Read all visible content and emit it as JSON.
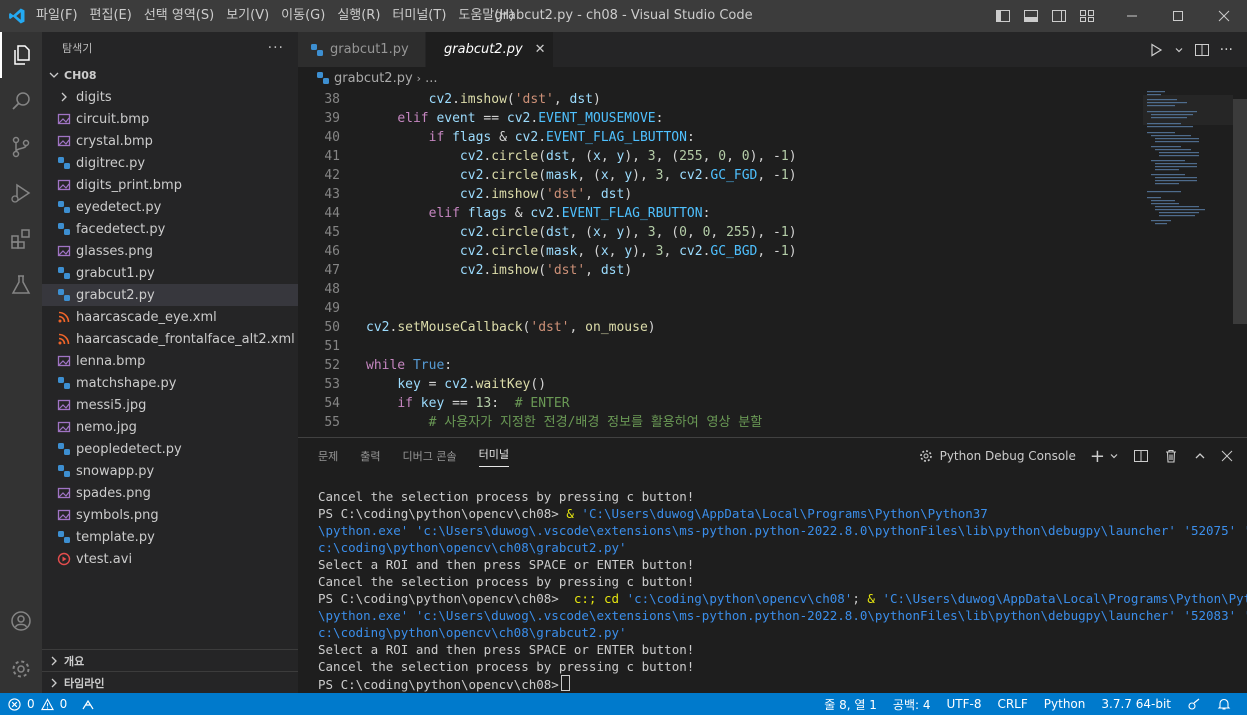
{
  "window": {
    "title": "grabcut2.py - ch08 - Visual Studio Code"
  },
  "menu": [
    "파일(F)",
    "편집(E)",
    "선택 영역(S)",
    "보기(V)",
    "이동(G)",
    "실행(R)",
    "터미널(T)",
    "도움말(H)"
  ],
  "explorer": {
    "title": "탐색기",
    "folder": "CH08",
    "items": [
      {
        "name": "digits",
        "type": "folder"
      },
      {
        "name": "circuit.bmp",
        "type": "image"
      },
      {
        "name": "crystal.bmp",
        "type": "image"
      },
      {
        "name": "digitrec.py",
        "type": "python"
      },
      {
        "name": "digits_print.bmp",
        "type": "image"
      },
      {
        "name": "eyedetect.py",
        "type": "python"
      },
      {
        "name": "facedetect.py",
        "type": "python"
      },
      {
        "name": "glasses.png",
        "type": "image"
      },
      {
        "name": "grabcut1.py",
        "type": "python"
      },
      {
        "name": "grabcut2.py",
        "type": "python"
      },
      {
        "name": "haarcascade_eye.xml",
        "type": "xml"
      },
      {
        "name": "haarcascade_frontalface_alt2.xml",
        "type": "xml"
      },
      {
        "name": "lenna.bmp",
        "type": "image"
      },
      {
        "name": "matchshape.py",
        "type": "python"
      },
      {
        "name": "messi5.jpg",
        "type": "image"
      },
      {
        "name": "nemo.jpg",
        "type": "image"
      },
      {
        "name": "peopledetect.py",
        "type": "python"
      },
      {
        "name": "snowapp.py",
        "type": "python"
      },
      {
        "name": "spades.png",
        "type": "image"
      },
      {
        "name": "symbols.png",
        "type": "image"
      },
      {
        "name": "template.py",
        "type": "python"
      },
      {
        "name": "vtest.avi",
        "type": "video"
      }
    ],
    "outline": "개요",
    "timeline": "타임라인"
  },
  "tabs": [
    {
      "label": "grabcut1.py"
    },
    {
      "label": "grabcut2.py"
    }
  ],
  "breadcrumb": {
    "file": "grabcut2.py",
    "rest": "..."
  },
  "editor": {
    "lines": [
      {
        "n": "38",
        "code": [
          {
            "t": "        "
          },
          {
            "t": "cv2",
            "c": "var"
          },
          {
            "t": "."
          },
          {
            "t": "imshow",
            "c": "fn"
          },
          {
            "t": "("
          },
          {
            "t": "'dst'",
            "c": "str"
          },
          {
            "t": ", "
          },
          {
            "t": "dst",
            "c": "var"
          },
          {
            "t": ")"
          }
        ]
      },
      {
        "n": "39",
        "code": [
          {
            "t": "    "
          },
          {
            "t": "elif",
            "c": "kw"
          },
          {
            "t": " "
          },
          {
            "t": "event",
            "c": "var"
          },
          {
            "t": " == "
          },
          {
            "t": "cv2",
            "c": "var"
          },
          {
            "t": "."
          },
          {
            "t": "EVENT_MOUSEMOVE",
            "c": "cst"
          },
          {
            "t": ":"
          }
        ]
      },
      {
        "n": "40",
        "code": [
          {
            "t": "        "
          },
          {
            "t": "if",
            "c": "kw"
          },
          {
            "t": " "
          },
          {
            "t": "flags",
            "c": "var"
          },
          {
            "t": " & "
          },
          {
            "t": "cv2",
            "c": "var"
          },
          {
            "t": "."
          },
          {
            "t": "EVENT_FLAG_LBUTTON",
            "c": "cst"
          },
          {
            "t": ":"
          }
        ]
      },
      {
        "n": "41",
        "code": [
          {
            "t": "            "
          },
          {
            "t": "cv2",
            "c": "var"
          },
          {
            "t": "."
          },
          {
            "t": "circle",
            "c": "fn"
          },
          {
            "t": "("
          },
          {
            "t": "dst",
            "c": "var"
          },
          {
            "t": ", ("
          },
          {
            "t": "x",
            "c": "var"
          },
          {
            "t": ", "
          },
          {
            "t": "y",
            "c": "var"
          },
          {
            "t": "), "
          },
          {
            "t": "3",
            "c": "num"
          },
          {
            "t": ", ("
          },
          {
            "t": "255",
            "c": "num"
          },
          {
            "t": ", "
          },
          {
            "t": "0",
            "c": "num"
          },
          {
            "t": ", "
          },
          {
            "t": "0",
            "c": "num"
          },
          {
            "t": "), -"
          },
          {
            "t": "1",
            "c": "num"
          },
          {
            "t": ")"
          }
        ]
      },
      {
        "n": "42",
        "code": [
          {
            "t": "            "
          },
          {
            "t": "cv2",
            "c": "var"
          },
          {
            "t": "."
          },
          {
            "t": "circle",
            "c": "fn"
          },
          {
            "t": "("
          },
          {
            "t": "mask",
            "c": "var"
          },
          {
            "t": ", ("
          },
          {
            "t": "x",
            "c": "var"
          },
          {
            "t": ", "
          },
          {
            "t": "y",
            "c": "var"
          },
          {
            "t": "), "
          },
          {
            "t": "3",
            "c": "num"
          },
          {
            "t": ", "
          },
          {
            "t": "cv2",
            "c": "var"
          },
          {
            "t": "."
          },
          {
            "t": "GC_FGD",
            "c": "cst"
          },
          {
            "t": ", -"
          },
          {
            "t": "1",
            "c": "num"
          },
          {
            "t": ")"
          }
        ]
      },
      {
        "n": "43",
        "code": [
          {
            "t": "            "
          },
          {
            "t": "cv2",
            "c": "var"
          },
          {
            "t": "."
          },
          {
            "t": "imshow",
            "c": "fn"
          },
          {
            "t": "("
          },
          {
            "t": "'dst'",
            "c": "str"
          },
          {
            "t": ", "
          },
          {
            "t": "dst",
            "c": "var"
          },
          {
            "t": ")"
          }
        ]
      },
      {
        "n": "44",
        "code": [
          {
            "t": "        "
          },
          {
            "t": "elif",
            "c": "kw"
          },
          {
            "t": " "
          },
          {
            "t": "flags",
            "c": "var"
          },
          {
            "t": " & "
          },
          {
            "t": "cv2",
            "c": "var"
          },
          {
            "t": "."
          },
          {
            "t": "EVENT_FLAG_RBUTTON",
            "c": "cst"
          },
          {
            "t": ":"
          }
        ]
      },
      {
        "n": "45",
        "code": [
          {
            "t": "            "
          },
          {
            "t": "cv2",
            "c": "var"
          },
          {
            "t": "."
          },
          {
            "t": "circle",
            "c": "fn"
          },
          {
            "t": "("
          },
          {
            "t": "dst",
            "c": "var"
          },
          {
            "t": ", ("
          },
          {
            "t": "x",
            "c": "var"
          },
          {
            "t": ", "
          },
          {
            "t": "y",
            "c": "var"
          },
          {
            "t": "), "
          },
          {
            "t": "3",
            "c": "num"
          },
          {
            "t": ", ("
          },
          {
            "t": "0",
            "c": "num"
          },
          {
            "t": ", "
          },
          {
            "t": "0",
            "c": "num"
          },
          {
            "t": ", "
          },
          {
            "t": "255",
            "c": "num"
          },
          {
            "t": "), -"
          },
          {
            "t": "1",
            "c": "num"
          },
          {
            "t": ")"
          }
        ]
      },
      {
        "n": "46",
        "code": [
          {
            "t": "            "
          },
          {
            "t": "cv2",
            "c": "var"
          },
          {
            "t": "."
          },
          {
            "t": "circle",
            "c": "fn"
          },
          {
            "t": "("
          },
          {
            "t": "mask",
            "c": "var"
          },
          {
            "t": ", ("
          },
          {
            "t": "x",
            "c": "var"
          },
          {
            "t": ", "
          },
          {
            "t": "y",
            "c": "var"
          },
          {
            "t": "), "
          },
          {
            "t": "3",
            "c": "num"
          },
          {
            "t": ", "
          },
          {
            "t": "cv2",
            "c": "var"
          },
          {
            "t": "."
          },
          {
            "t": "GC_BGD",
            "c": "cst"
          },
          {
            "t": ", -"
          },
          {
            "t": "1",
            "c": "num"
          },
          {
            "t": ")"
          }
        ]
      },
      {
        "n": "47",
        "code": [
          {
            "t": "            "
          },
          {
            "t": "cv2",
            "c": "var"
          },
          {
            "t": "."
          },
          {
            "t": "imshow",
            "c": "fn"
          },
          {
            "t": "("
          },
          {
            "t": "'dst'",
            "c": "str"
          },
          {
            "t": ", "
          },
          {
            "t": "dst",
            "c": "var"
          },
          {
            "t": ")"
          }
        ]
      },
      {
        "n": "48",
        "code": []
      },
      {
        "n": "49",
        "code": []
      },
      {
        "n": "50",
        "code": [
          {
            "t": "cv2",
            "c": "var"
          },
          {
            "t": "."
          },
          {
            "t": "setMouseCallback",
            "c": "fn"
          },
          {
            "t": "("
          },
          {
            "t": "'dst'",
            "c": "str"
          },
          {
            "t": ", "
          },
          {
            "t": "on_mouse",
            "c": "fn"
          },
          {
            "t": ")"
          }
        ]
      },
      {
        "n": "51",
        "code": []
      },
      {
        "n": "52",
        "code": [
          {
            "t": "while",
            "c": "kw"
          },
          {
            "t": " "
          },
          {
            "t": "True",
            "c": "kw2"
          },
          {
            "t": ":"
          }
        ]
      },
      {
        "n": "53",
        "code": [
          {
            "t": "    "
          },
          {
            "t": "key",
            "c": "var"
          },
          {
            "t": " = "
          },
          {
            "t": "cv2",
            "c": "var"
          },
          {
            "t": "."
          },
          {
            "t": "waitKey",
            "c": "fn"
          },
          {
            "t": "()"
          }
        ]
      },
      {
        "n": "54",
        "code": [
          {
            "t": "    "
          },
          {
            "t": "if",
            "c": "kw"
          },
          {
            "t": " "
          },
          {
            "t": "key",
            "c": "var"
          },
          {
            "t": " == "
          },
          {
            "t": "13",
            "c": "num"
          },
          {
            "t": ":  "
          },
          {
            "t": "# ENTER",
            "c": "cm"
          }
        ]
      },
      {
        "n": "55",
        "code": [
          {
            "t": "        "
          },
          {
            "t": "# 사용자가 지정한 전경/배경 정보를 활용하여 영상 분할",
            "c": "cm"
          }
        ]
      }
    ]
  },
  "panel": {
    "tabs": [
      "문제",
      "출력",
      "디버그 콘솔",
      "터미널"
    ],
    "debug_label": "Python Debug Console",
    "terminal": [
      [
        {
          "t": "Cancel the selection process by pressing c button!"
        }
      ],
      [
        {
          "t": "PS C:\\coding\\python\\opencv\\ch08> "
        },
        {
          "t": "& ",
          "c": "tyellow"
        },
        {
          "t": "'C:\\Users\\duwog\\AppData\\Local\\Programs\\Python\\Python37",
          "c": "tblue"
        }
      ],
      [
        {
          "t": "\\python.exe' 'c:\\Users\\duwog\\.vscode\\extensions\\ms-python.python-2022.8.0\\pythonFiles\\lib\\python\\debugpy\\launcher' '52075' '--' '",
          "c": "tblue"
        }
      ],
      [
        {
          "t": "c:\\coding\\python\\opencv\\ch08\\grabcut2.py'",
          "c": "tblue"
        }
      ],
      [
        {
          "t": "Select a ROI and then press SPACE or ENTER button!"
        }
      ],
      [
        {
          "t": "Cancel the selection process by pressing c button!"
        }
      ],
      [
        {
          "t": "PS C:\\coding\\python\\opencv\\ch08>  "
        },
        {
          "t": "c:; cd ",
          "c": "tyellow"
        },
        {
          "t": "'c:\\coding\\python\\opencv\\ch08'",
          "c": "tblue"
        },
        {
          "t": "; "
        },
        {
          "t": "& ",
          "c": "tyellow"
        },
        {
          "t": "'C:\\Users\\duwog\\AppData\\Local\\Programs\\Python\\Python37",
          "c": "tblue"
        }
      ],
      [
        {
          "t": "\\python.exe' 'c:\\Users\\duwog\\.vscode\\extensions\\ms-python.python-2022.8.0\\pythonFiles\\lib\\python\\debugpy\\launcher' '52083' '--' '",
          "c": "tblue"
        }
      ],
      [
        {
          "t": "c:\\coding\\python\\opencv\\ch08\\grabcut2.py'",
          "c": "tblue"
        }
      ],
      [
        {
          "t": "Select a ROI and then press SPACE or ENTER button!"
        }
      ],
      [
        {
          "t": "Cancel the selection process by pressing c button!"
        }
      ],
      [
        {
          "t": "PS C:\\coding\\python\\opencv\\ch08>"
        }
      ]
    ]
  },
  "status": {
    "errors": "0",
    "warnings": "0",
    "position": "줄 8, 열 1",
    "spaces": "공백: 4",
    "encoding": "UTF-8",
    "eol": "CRLF",
    "language": "Python",
    "interpreter": "3.7.7 64-bit"
  },
  "colors": {
    "accent": "#007acc",
    "python_icon": "#3d8fd1",
    "image_icon": "#a074c4",
    "xml_icon": "#f16529",
    "video_icon": "#e44d4d"
  }
}
